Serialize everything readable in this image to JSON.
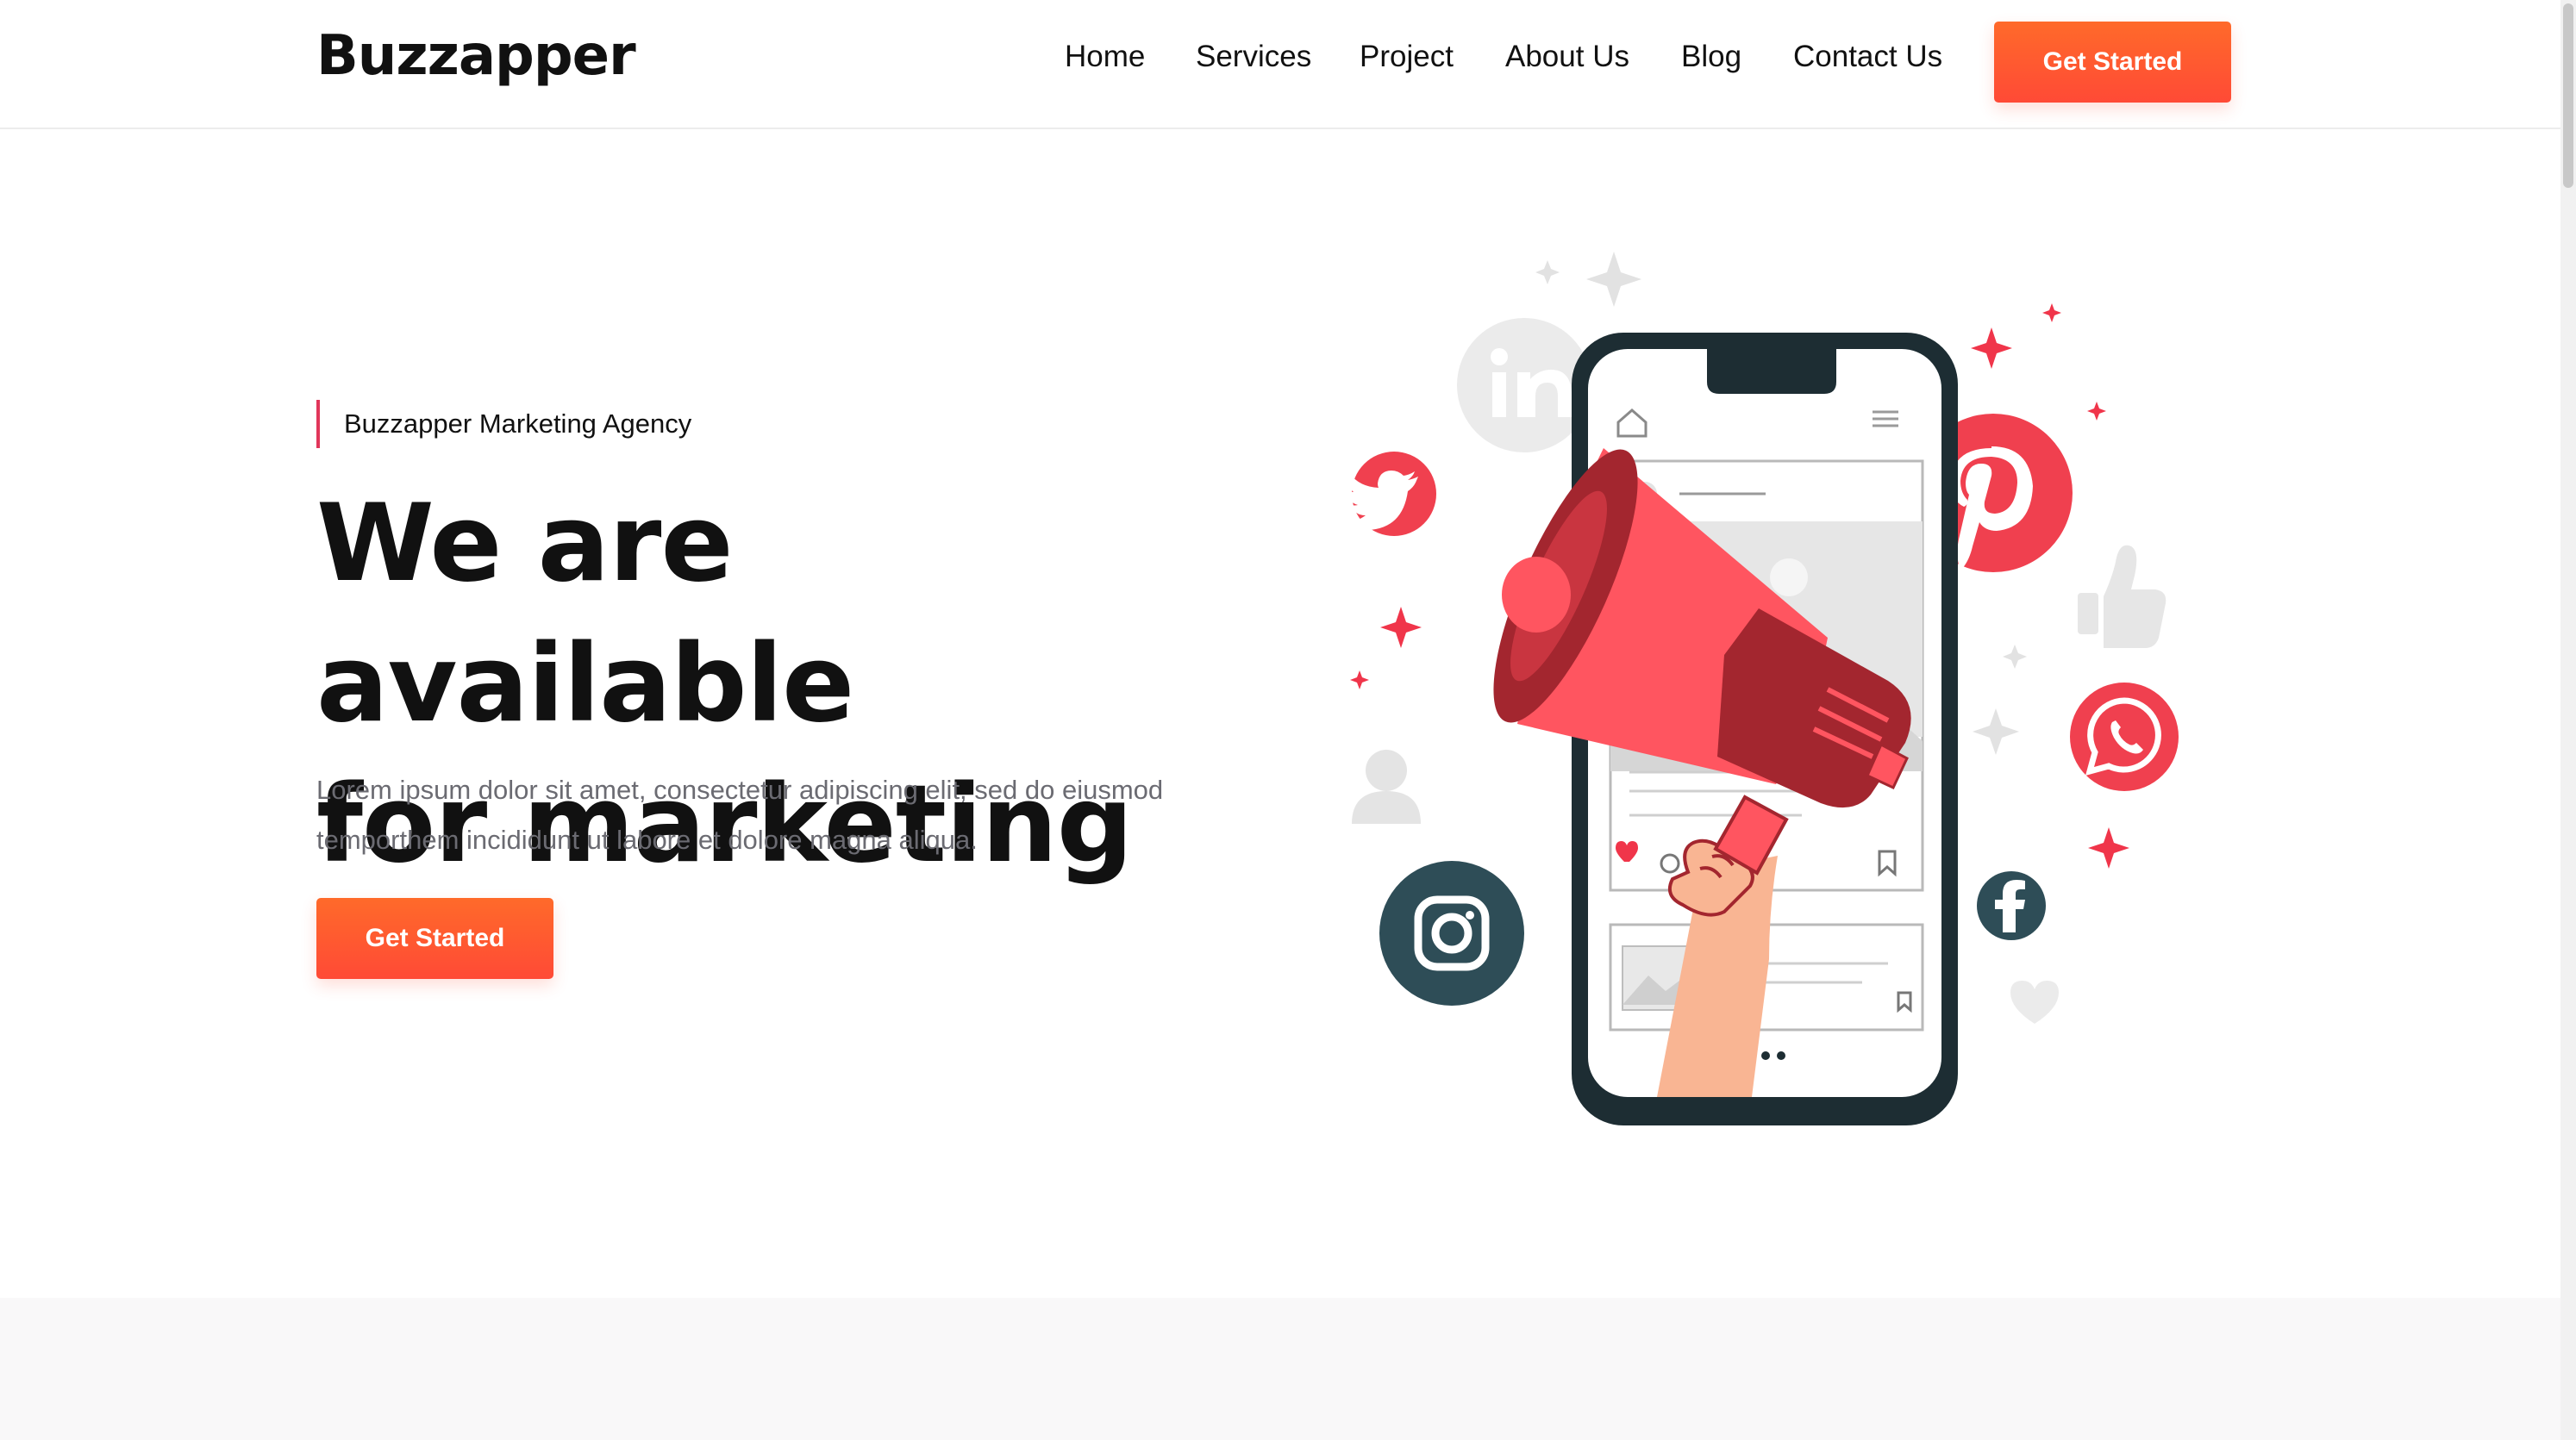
{
  "header": {
    "logo": "Buzzapper",
    "nav": [
      {
        "label": "Home"
      },
      {
        "label": "Services"
      },
      {
        "label": "Project"
      },
      {
        "label": "About Us"
      },
      {
        "label": "Blog"
      },
      {
        "label": "Contact Us"
      }
    ],
    "cta_label": "Get Started"
  },
  "hero": {
    "tagline": "Buzzapper Marketing Agency",
    "headline_line1": "We are available",
    "headline_line2": "for marketing",
    "description_line1": "Lorem ipsum dolor sit amet, consectetur adipiscing elit, sed do eiusmod",
    "description_line2": "temporthem incididunt ut labore et dolore magna aliqua.",
    "cta_label": "Get Started"
  },
  "illustration": {
    "icons": [
      "linkedin-icon",
      "twitter-icon",
      "pinterest-icon",
      "whatsapp-icon",
      "instagram-icon",
      "facebook-icon",
      "thumbs-up-icon",
      "user-icon",
      "heart-icon",
      "megaphone-icon"
    ]
  },
  "colors": {
    "accent": "#ff5a30",
    "accent_pink": "#e1365a",
    "megaphone_red": "#ff5560",
    "megaphone_dark": "#a3262f",
    "phone_dark": "#1d2d33",
    "instagram_teal": "#2e4d57",
    "text_muted": "#6b6b72"
  }
}
